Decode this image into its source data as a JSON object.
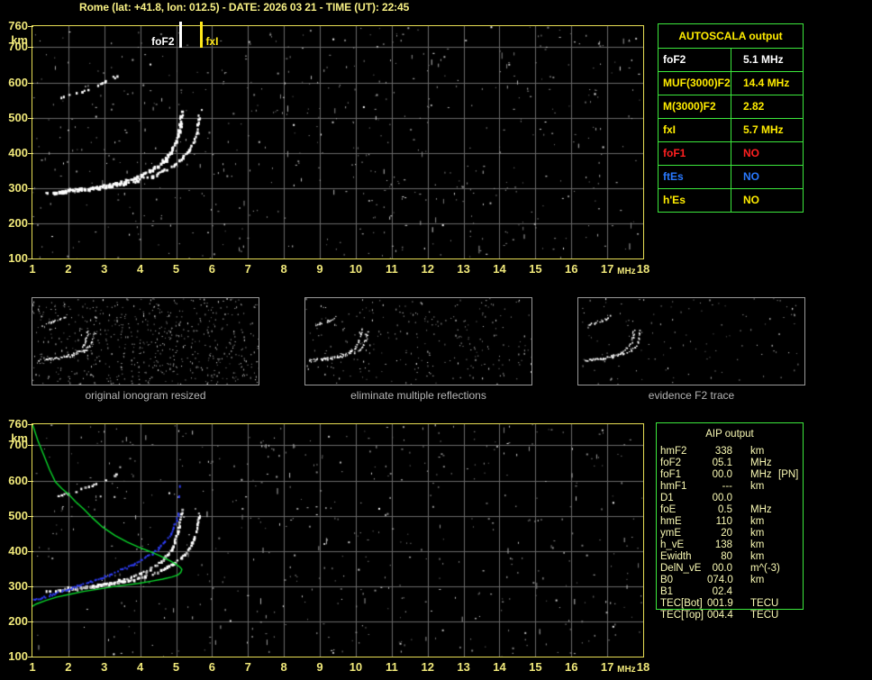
{
  "title": "Rome (lat: +41.8, lon: 012.5) - DATE: 2026 03 21 - TIME (UT): 22:45",
  "colors": {
    "background": "#000000",
    "title_yellow": "#f7f084",
    "axis_yellow": "#f0e87a",
    "border_yellow": "#e8de54",
    "table_green": "#3ce83c",
    "table_yellow": "#ffec00",
    "white": "#ffffff",
    "red": "#ff2020",
    "blue": "#2979ff",
    "aip_pale_yellow": "#fafab4",
    "grid_gray": "#6a6a6a",
    "caption_gray": "#b4b4b4",
    "profile_green": "#0ad42a",
    "fit_blue": "#2d3cf0"
  },
  "autoscala_table": {
    "title": "AUTOSCALA output",
    "rows": [
      {
        "label": "foF2",
        "value": "5.1 MHz",
        "color": "#ffffff"
      },
      {
        "label": "MUF(3000)F2",
        "value": "14.4 MHz",
        "color": "#ffec00"
      },
      {
        "label": "M(3000)F2",
        "value": "2.82",
        "color": "#ffec00"
      },
      {
        "label": "fxI",
        "value": "5.7 MHz",
        "color": "#ffec00"
      },
      {
        "label": "foF1",
        "value": "NO",
        "color": "#ff2020"
      },
      {
        "label": "ftEs",
        "value": "NO",
        "color": "#2979ff"
      },
      {
        "label": "h'Es",
        "value": "NO",
        "color": "#ffec00"
      }
    ]
  },
  "aip_table": {
    "title": "AIP output",
    "rows": [
      {
        "label": "hmF2",
        "value": "338",
        "unit": "km",
        "note": ""
      },
      {
        "label": "foF2",
        "value": "05.1",
        "unit": "MHz",
        "note": ""
      },
      {
        "label": "foF1",
        "value": "00.0",
        "unit": "MHz",
        "note": "[PN]"
      },
      {
        "label": "hmF1",
        "value": "---",
        "unit": "km",
        "note": ""
      },
      {
        "label": "D1",
        "value": "00.0",
        "unit": "",
        "note": ""
      },
      {
        "label": "foE",
        "value": "0.5",
        "unit": "MHz",
        "note": ""
      },
      {
        "label": "hmE",
        "value": "110",
        "unit": "km",
        "note": ""
      },
      {
        "label": "ymE",
        "value": "20",
        "unit": "km",
        "note": ""
      },
      {
        "label": "h_vE",
        "value": "138",
        "unit": "km",
        "note": ""
      },
      {
        "label": "Ewidth",
        "value": "80",
        "unit": "km",
        "note": ""
      },
      {
        "label": "DelN_vE",
        "value": "00.0",
        "unit": "m^(-3)",
        "note": ""
      },
      {
        "label": "B0",
        "value": "074.0",
        "unit": "km",
        "note": ""
      },
      {
        "label": "B1",
        "value": "02.4",
        "unit": "",
        "note": ""
      },
      {
        "label": "TEC[Bot]",
        "value": "001.9",
        "unit": "TECU",
        "note": ""
      },
      {
        "label": "TEC[Top]",
        "value": "004.4",
        "unit": "TECU",
        "note": ""
      }
    ]
  },
  "thumbnails": [
    {
      "caption": "original ionogram resized",
      "noise_dots": 640
    },
    {
      "caption": "eliminate multiple reflections",
      "noise_dots": 270
    },
    {
      "caption": "evidence F2 trace",
      "noise_dots": 120
    }
  ],
  "chart_data": [
    {
      "id": "autoscaled_ionogram",
      "type": "scatter",
      "title": "",
      "xlabel": "MHz",
      "ylabel": "km",
      "xlim": [
        1,
        18
      ],
      "ylim": [
        100,
        760
      ],
      "x_ticks": [
        1,
        2,
        3,
        4,
        5,
        6,
        7,
        8,
        9,
        10,
        11,
        12,
        13,
        14,
        15,
        16,
        17,
        18
      ],
      "y_ticks": [
        760,
        700,
        600,
        500,
        400,
        300,
        200,
        100
      ],
      "grid": true,
      "noise": {
        "dots": 540,
        "streaks": 60
      },
      "markers": [
        {
          "label": "foF2",
          "x": 5.1,
          "color": "#ffffff",
          "side": "left"
        },
        {
          "label": "fxI",
          "x": 5.7,
          "color": "#ffe81a",
          "side": "right"
        }
      ],
      "series": [
        {
          "name": "F2 ordinary trace",
          "render": "dash-trace",
          "color": "#ffffff",
          "dash": {
            "step": 2.2,
            "skip": 0.1,
            "w": [
              2,
              4
            ],
            "h": [
              2,
              5
            ]
          },
          "points": [
            [
              1.35,
              289
            ],
            [
              1.6,
              291
            ],
            [
              1.9,
              293
            ],
            [
              2.2,
              296
            ],
            [
              2.5,
              300
            ],
            [
              2.8,
              305
            ],
            [
              3.1,
              311
            ],
            [
              3.4,
              318
            ],
            [
              3.7,
              327
            ],
            [
              4.0,
              338
            ],
            [
              4.25,
              352
            ],
            [
              4.5,
              368
            ],
            [
              4.7,
              388
            ],
            [
              4.85,
              410
            ],
            [
              4.95,
              432
            ],
            [
              5.03,
              458
            ],
            [
              5.08,
              482
            ],
            [
              5.12,
              505
            ],
            [
              5.15,
              518
            ]
          ]
        },
        {
          "name": "F2 extraordinary trace",
          "render": "dash-trace",
          "color": "#ffffff",
          "dash": {
            "step": 2.4,
            "skip": 0.13,
            "w": [
              2,
              3
            ],
            "h": [
              2,
              4
            ]
          },
          "points": [
            [
              1.9,
              297
            ],
            [
              2.3,
              299
            ],
            [
              2.7,
              303
            ],
            [
              3.1,
              308
            ],
            [
              3.5,
              315
            ],
            [
              3.9,
              324
            ],
            [
              4.3,
              336
            ],
            [
              4.6,
              350
            ],
            [
              4.9,
              367
            ],
            [
              5.15,
              387
            ],
            [
              5.35,
              411
            ],
            [
              5.47,
              436
            ],
            [
              5.55,
              462
            ],
            [
              5.6,
              488
            ],
            [
              5.62,
              510
            ]
          ]
        },
        {
          "name": "second hop echo",
          "render": "dash-trace",
          "color": "#ffffff",
          "dash": {
            "step": 3.0,
            "skip": 0.38,
            "w": [
              2,
              3
            ],
            "h": [
              2,
              3
            ]
          },
          "points": [
            [
              1.7,
              558
            ],
            [
              2.0,
              567
            ],
            [
              2.35,
              578
            ],
            [
              2.7,
              591
            ],
            [
              3.0,
              604
            ],
            [
              3.25,
              616
            ],
            [
              3.4,
              625
            ]
          ]
        }
      ]
    },
    {
      "id": "profile_ionogram",
      "type": "scatter",
      "title": "",
      "xlabel": "MHz",
      "ylabel": "km",
      "xlim": [
        1,
        18
      ],
      "ylim": [
        100,
        760
      ],
      "x_ticks": [
        1,
        2,
        3,
        4,
        5,
        6,
        7,
        8,
        9,
        10,
        11,
        12,
        13,
        14,
        15,
        16,
        17,
        18
      ],
      "y_ticks": [
        760,
        700,
        600,
        500,
        400,
        300,
        200,
        100
      ],
      "grid": true,
      "noise": {
        "dots": 470,
        "streaks": 55
      },
      "markers": [],
      "series": [
        {
          "name": "F2 ordinary trace",
          "render": "dash-trace",
          "color": "#ffffff",
          "dash": {
            "step": 2.4,
            "skip": 0.14,
            "w": [
              2,
              3
            ],
            "h": [
              2,
              4
            ]
          },
          "points": [
            [
              1.35,
              289
            ],
            [
              1.6,
              291
            ],
            [
              1.9,
              293
            ],
            [
              2.2,
              296
            ],
            [
              2.5,
              300
            ],
            [
              2.8,
              305
            ],
            [
              3.1,
              311
            ],
            [
              3.4,
              318
            ],
            [
              3.7,
              327
            ],
            [
              4.0,
              338
            ],
            [
              4.25,
              352
            ],
            [
              4.5,
              368
            ],
            [
              4.7,
              388
            ],
            [
              4.85,
              410
            ],
            [
              4.95,
              432
            ],
            [
              5.03,
              458
            ],
            [
              5.08,
              482
            ],
            [
              5.12,
              505
            ],
            [
              5.15,
              518
            ]
          ]
        },
        {
          "name": "F2 extraordinary trace",
          "render": "dash-trace",
          "color": "#ffffff",
          "dash": {
            "step": 2.6,
            "skip": 0.16,
            "w": [
              2,
              3
            ],
            "h": [
              2,
              4
            ]
          },
          "points": [
            [
              1.9,
              297
            ],
            [
              2.3,
              299
            ],
            [
              2.7,
              303
            ],
            [
              3.1,
              308
            ],
            [
              3.5,
              315
            ],
            [
              3.9,
              324
            ],
            [
              4.3,
              336
            ],
            [
              4.6,
              350
            ],
            [
              4.9,
              367
            ],
            [
              5.15,
              387
            ],
            [
              5.35,
              411
            ],
            [
              5.47,
              436
            ],
            [
              5.55,
              462
            ],
            [
              5.6,
              488
            ],
            [
              5.62,
              510
            ]
          ]
        },
        {
          "name": "second hop echo",
          "render": "dash-trace",
          "color": "#ffffff",
          "dash": {
            "step": 3.0,
            "skip": 0.4,
            "w": [
              2,
              3
            ],
            "h": [
              2,
              3
            ]
          },
          "points": [
            [
              1.7,
              558
            ],
            [
              2.0,
              567
            ],
            [
              2.35,
              578
            ],
            [
              2.7,
              591
            ],
            [
              3.0,
              604
            ],
            [
              3.25,
              616
            ],
            [
              3.4,
              625
            ]
          ]
        },
        {
          "name": "autoscaled trace fit",
          "render": "dots",
          "color": "#2d3cf0",
          "points": [
            [
              1.0,
              262
            ],
            [
              1.25,
              269
            ],
            [
              1.5,
              277
            ],
            [
              1.75,
              285
            ],
            [
              2.0,
              294
            ],
            [
              2.3,
              304
            ],
            [
              2.6,
              314
            ],
            [
              2.9,
              325
            ],
            [
              3.2,
              337
            ],
            [
              3.5,
              350
            ],
            [
              3.8,
              364
            ],
            [
              4.05,
              378
            ],
            [
              4.3,
              394
            ],
            [
              4.5,
              411
            ],
            [
              4.68,
              429
            ],
            [
              4.82,
              449
            ],
            [
              4.92,
              469
            ],
            [
              4.99,
              488
            ],
            [
              5.03,
              500
            ]
          ],
          "extra_points": [
            [
              5.06,
              558
            ],
            [
              5.08,
              587
            ],
            [
              5.04,
              509
            ]
          ]
        },
        {
          "name": "electron density profile",
          "render": "line",
          "color": "#0ad42a",
          "points": [
            [
              1.0,
              760
            ],
            [
              1.15,
              714
            ],
            [
              1.32,
              671
            ],
            [
              1.48,
              630
            ],
            [
              1.64,
              596
            ],
            [
              1.82,
              577
            ],
            [
              2.0,
              562
            ],
            [
              2.2,
              540
            ],
            [
              2.43,
              519
            ],
            [
              2.68,
              493
            ],
            [
              2.95,
              468
            ],
            [
              3.3,
              444
            ],
            [
              3.64,
              425
            ],
            [
              3.95,
              411
            ],
            [
              4.23,
              400
            ],
            [
              4.55,
              386
            ],
            [
              4.83,
              372
            ],
            [
              5.0,
              362
            ],
            [
              5.11,
              354
            ],
            [
              5.16,
              348
            ],
            [
              5.13,
              339
            ],
            [
              5.05,
              332
            ],
            [
              4.88,
              326
            ],
            [
              4.62,
              320
            ],
            [
              4.3,
              314
            ],
            [
              3.95,
              308
            ],
            [
              3.58,
              303
            ],
            [
              3.2,
              298
            ],
            [
              2.8,
              291
            ],
            [
              2.43,
              285
            ],
            [
              2.05,
              277
            ],
            [
              1.68,
              269
            ],
            [
              1.36,
              259
            ],
            [
              1.1,
              249
            ],
            [
              0.97,
              241
            ],
            [
              0.94,
              234
            ]
          ]
        }
      ]
    }
  ]
}
